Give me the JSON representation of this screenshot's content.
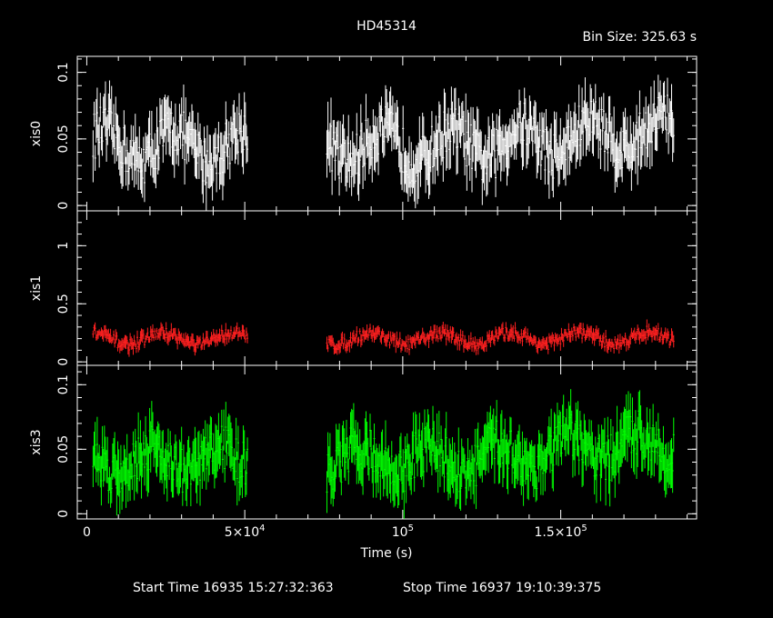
{
  "chart_data": {
    "type": "line",
    "title": "HD45314",
    "bin_size_label": "Bin Size: 325.63 s",
    "xlabel": "Time (s)",
    "xlim": [
      -3000,
      193000
    ],
    "x_ticks": [
      {
        "value": 0,
        "label": "0"
      },
      {
        "value": 50000,
        "label": "5×10",
        "sup": "4"
      },
      {
        "value": 100000,
        "label": "10",
        "sup": "5"
      },
      {
        "value": 150000,
        "label": "1.5×10",
        "sup": "5"
      }
    ],
    "start_time": "Start Time 16935 15:27:32:363",
    "stop_time": "Stop Time 16937 19:10:39:375",
    "panels": [
      {
        "name": "xis0",
        "ylabel": "xis0",
        "color": "#ffffff",
        "ylim": [
          -0.004,
          0.112
        ],
        "yticks": [
          {
            "value": 0,
            "label": "0"
          },
          {
            "value": 0.05,
            "label": "0.05"
          },
          {
            "value": 0.1,
            "label": "0.1"
          }
        ],
        "base": 0.045,
        "amp": 0.012,
        "spread": 0.018,
        "late_boost": 0.012
      },
      {
        "name": "xis1",
        "ylabel": "xis1",
        "color": "#ff2020",
        "ylim": [
          -0.03,
          1.3
        ],
        "yticks": [
          {
            "value": 0,
            "label": "0"
          },
          {
            "value": 0.5,
            "label": "0.5"
          },
          {
            "value": 1,
            "label": "1"
          }
        ],
        "base": 0.2,
        "amp": 0.05,
        "spread": 0.05,
        "late_boost": 0.01
      },
      {
        "name": "xis3",
        "ylabel": "xis3",
        "color": "#00ff00",
        "ylim": [
          -0.004,
          0.115
        ],
        "yticks": [
          {
            "value": 0,
            "label": "0"
          },
          {
            "value": 0.05,
            "label": "0.05"
          },
          {
            "value": 0.1,
            "label": "0.1"
          }
        ],
        "base": 0.042,
        "amp": 0.01,
        "spread": 0.018,
        "late_boost": 0.014
      }
    ],
    "segments": [
      [
        2000,
        51000
      ],
      [
        76000,
        186000
      ]
    ],
    "bin_size_s": 325.63
  }
}
